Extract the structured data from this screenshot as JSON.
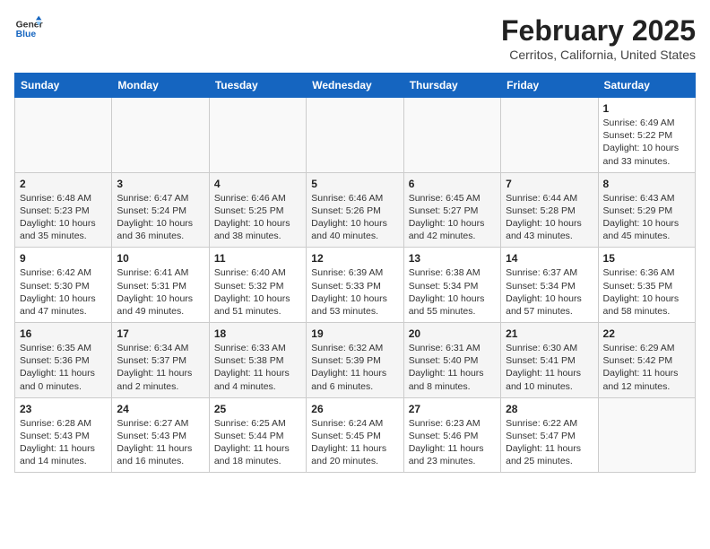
{
  "header": {
    "logo_line1": "General",
    "logo_line2": "Blue",
    "month_year": "February 2025",
    "location": "Cerritos, California, United States"
  },
  "days_of_week": [
    "Sunday",
    "Monday",
    "Tuesday",
    "Wednesday",
    "Thursday",
    "Friday",
    "Saturday"
  ],
  "weeks": [
    [
      {
        "day": "",
        "text": ""
      },
      {
        "day": "",
        "text": ""
      },
      {
        "day": "",
        "text": ""
      },
      {
        "day": "",
        "text": ""
      },
      {
        "day": "",
        "text": ""
      },
      {
        "day": "",
        "text": ""
      },
      {
        "day": "1",
        "text": "Sunrise: 6:49 AM\nSunset: 5:22 PM\nDaylight: 10 hours and 33 minutes."
      }
    ],
    [
      {
        "day": "2",
        "text": "Sunrise: 6:48 AM\nSunset: 5:23 PM\nDaylight: 10 hours and 35 minutes."
      },
      {
        "day": "3",
        "text": "Sunrise: 6:47 AM\nSunset: 5:24 PM\nDaylight: 10 hours and 36 minutes."
      },
      {
        "day": "4",
        "text": "Sunrise: 6:46 AM\nSunset: 5:25 PM\nDaylight: 10 hours and 38 minutes."
      },
      {
        "day": "5",
        "text": "Sunrise: 6:46 AM\nSunset: 5:26 PM\nDaylight: 10 hours and 40 minutes."
      },
      {
        "day": "6",
        "text": "Sunrise: 6:45 AM\nSunset: 5:27 PM\nDaylight: 10 hours and 42 minutes."
      },
      {
        "day": "7",
        "text": "Sunrise: 6:44 AM\nSunset: 5:28 PM\nDaylight: 10 hours and 43 minutes."
      },
      {
        "day": "8",
        "text": "Sunrise: 6:43 AM\nSunset: 5:29 PM\nDaylight: 10 hours and 45 minutes."
      }
    ],
    [
      {
        "day": "9",
        "text": "Sunrise: 6:42 AM\nSunset: 5:30 PM\nDaylight: 10 hours and 47 minutes."
      },
      {
        "day": "10",
        "text": "Sunrise: 6:41 AM\nSunset: 5:31 PM\nDaylight: 10 hours and 49 minutes."
      },
      {
        "day": "11",
        "text": "Sunrise: 6:40 AM\nSunset: 5:32 PM\nDaylight: 10 hours and 51 minutes."
      },
      {
        "day": "12",
        "text": "Sunrise: 6:39 AM\nSunset: 5:33 PM\nDaylight: 10 hours and 53 minutes."
      },
      {
        "day": "13",
        "text": "Sunrise: 6:38 AM\nSunset: 5:34 PM\nDaylight: 10 hours and 55 minutes."
      },
      {
        "day": "14",
        "text": "Sunrise: 6:37 AM\nSunset: 5:34 PM\nDaylight: 10 hours and 57 minutes."
      },
      {
        "day": "15",
        "text": "Sunrise: 6:36 AM\nSunset: 5:35 PM\nDaylight: 10 hours and 58 minutes."
      }
    ],
    [
      {
        "day": "16",
        "text": "Sunrise: 6:35 AM\nSunset: 5:36 PM\nDaylight: 11 hours and 0 minutes."
      },
      {
        "day": "17",
        "text": "Sunrise: 6:34 AM\nSunset: 5:37 PM\nDaylight: 11 hours and 2 minutes."
      },
      {
        "day": "18",
        "text": "Sunrise: 6:33 AM\nSunset: 5:38 PM\nDaylight: 11 hours and 4 minutes."
      },
      {
        "day": "19",
        "text": "Sunrise: 6:32 AM\nSunset: 5:39 PM\nDaylight: 11 hours and 6 minutes."
      },
      {
        "day": "20",
        "text": "Sunrise: 6:31 AM\nSunset: 5:40 PM\nDaylight: 11 hours and 8 minutes."
      },
      {
        "day": "21",
        "text": "Sunrise: 6:30 AM\nSunset: 5:41 PM\nDaylight: 11 hours and 10 minutes."
      },
      {
        "day": "22",
        "text": "Sunrise: 6:29 AM\nSunset: 5:42 PM\nDaylight: 11 hours and 12 minutes."
      }
    ],
    [
      {
        "day": "23",
        "text": "Sunrise: 6:28 AM\nSunset: 5:43 PM\nDaylight: 11 hours and 14 minutes."
      },
      {
        "day": "24",
        "text": "Sunrise: 6:27 AM\nSunset: 5:43 PM\nDaylight: 11 hours and 16 minutes."
      },
      {
        "day": "25",
        "text": "Sunrise: 6:25 AM\nSunset: 5:44 PM\nDaylight: 11 hours and 18 minutes."
      },
      {
        "day": "26",
        "text": "Sunrise: 6:24 AM\nSunset: 5:45 PM\nDaylight: 11 hours and 20 minutes."
      },
      {
        "day": "27",
        "text": "Sunrise: 6:23 AM\nSunset: 5:46 PM\nDaylight: 11 hours and 23 minutes."
      },
      {
        "day": "28",
        "text": "Sunrise: 6:22 AM\nSunset: 5:47 PM\nDaylight: 11 hours and 25 minutes."
      },
      {
        "day": "",
        "text": ""
      }
    ]
  ]
}
